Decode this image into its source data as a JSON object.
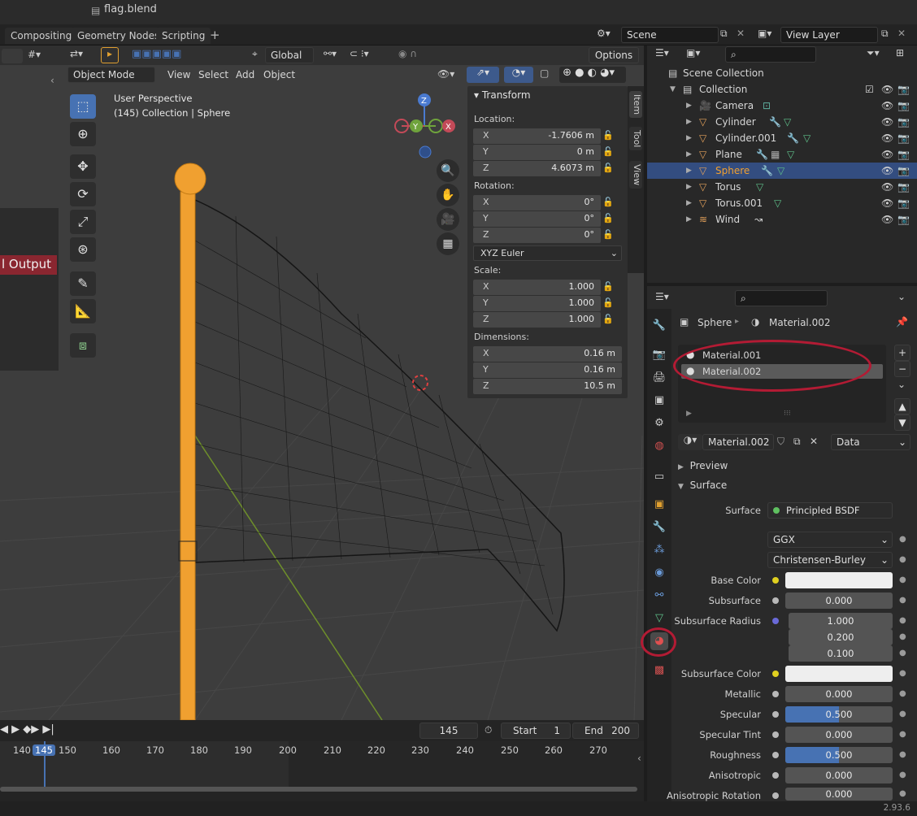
{
  "window": {
    "title": "flag.blend"
  },
  "workspace_tabs": [
    "Compositing",
    "Geometry Nodes",
    "Scripting"
  ],
  "scene": {
    "label": "Scene"
  },
  "view_layer": {
    "label": "View Layer"
  },
  "viewport": {
    "transform_orientation": "Global",
    "options_label": "Options",
    "mode": "Object Mode",
    "menus": [
      "View",
      "Select",
      "Add",
      "Object"
    ],
    "perspective_label": "User Perspective",
    "collection_label": "(145) Collection | Sphere",
    "node_label": "l Output",
    "gizmo": {
      "z": "Z",
      "y": "Y",
      "x": "X"
    }
  },
  "npanel": {
    "header": "Transform",
    "tabs": [
      "Item",
      "Tool",
      "View"
    ],
    "location_label": "Location:",
    "location": [
      {
        "axis": "X",
        "value": "-1.7606 m"
      },
      {
        "axis": "Y",
        "value": "0 m"
      },
      {
        "axis": "Z",
        "value": "4.6073 m"
      }
    ],
    "rotation_label": "Rotation:",
    "rotation": [
      {
        "axis": "X",
        "value": "0°"
      },
      {
        "axis": "Y",
        "value": "0°"
      },
      {
        "axis": "Z",
        "value": "0°"
      }
    ],
    "rotation_mode": "XYZ Euler",
    "scale_label": "Scale:",
    "scale": [
      {
        "axis": "X",
        "value": "1.000"
      },
      {
        "axis": "Y",
        "value": "1.000"
      },
      {
        "axis": "Z",
        "value": "1.000"
      }
    ],
    "dimensions_label": "Dimensions:",
    "dimensions": [
      {
        "axis": "X",
        "value": "0.16 m"
      },
      {
        "axis": "Y",
        "value": "0.16 m"
      },
      {
        "axis": "Z",
        "value": "10.5 m"
      }
    ]
  },
  "outliner": {
    "root": "Scene Collection",
    "collection": "Collection",
    "items": [
      {
        "name": "Camera",
        "selected": false
      },
      {
        "name": "Cylinder",
        "selected": false
      },
      {
        "name": "Cylinder.001",
        "selected": false
      },
      {
        "name": "Plane",
        "selected": false
      },
      {
        "name": "Sphere",
        "selected": true
      },
      {
        "name": "Torus",
        "selected": false
      },
      {
        "name": "Torus.001",
        "selected": false
      },
      {
        "name": "Wind",
        "selected": false
      }
    ]
  },
  "properties": {
    "breadcrumb_object": "Sphere",
    "breadcrumb_material": "Material.002",
    "slots": [
      "Material.001",
      "Material.002"
    ],
    "active_material": "Material.002",
    "link": "Data",
    "preview_label": "Preview",
    "surface_label": "Surface",
    "surface_shader_label": "Surface",
    "surface_shader": "Principled BSDF",
    "distribution": "GGX",
    "subsurface_method": "Christensen-Burley",
    "fields": [
      {
        "label": "Base Color",
        "value": "",
        "type": "color"
      },
      {
        "label": "Subsurface",
        "value": "0.000",
        "type": "num"
      },
      {
        "label": "Subsurface Radius",
        "value": "1.000",
        "type": "num"
      },
      {
        "label": "",
        "value": "0.200",
        "type": "num"
      },
      {
        "label": "",
        "value": "0.100",
        "type": "num"
      },
      {
        "label": "Subsurface Color",
        "value": "",
        "type": "color"
      },
      {
        "label": "Metallic",
        "value": "0.000",
        "type": "num"
      },
      {
        "label": "Specular",
        "value": "0.500",
        "type": "slider",
        "fill": 0.5
      },
      {
        "label": "Specular Tint",
        "value": "0.000",
        "type": "num"
      },
      {
        "label": "Roughness",
        "value": "0.500",
        "type": "slider",
        "fill": 0.5
      },
      {
        "label": "Anisotropic",
        "value": "0.000",
        "type": "num"
      },
      {
        "label": "Anisotropic Rotation",
        "value": "0.000",
        "type": "num"
      }
    ]
  },
  "timeline": {
    "current_frame": "145",
    "start_label": "Start",
    "start": "1",
    "end_label": "End",
    "end": "200",
    "ticks": [
      "140",
      "145",
      "150",
      "160",
      "170",
      "180",
      "190",
      "200",
      "210",
      "220",
      "230",
      "240",
      "250",
      "260",
      "270"
    ]
  },
  "status": {
    "version": "2.93.6"
  },
  "colors": {
    "selected": "#334d80",
    "accent": "#4772b3",
    "object": "#f0a030",
    "highlight_circle": "#b31b34"
  }
}
